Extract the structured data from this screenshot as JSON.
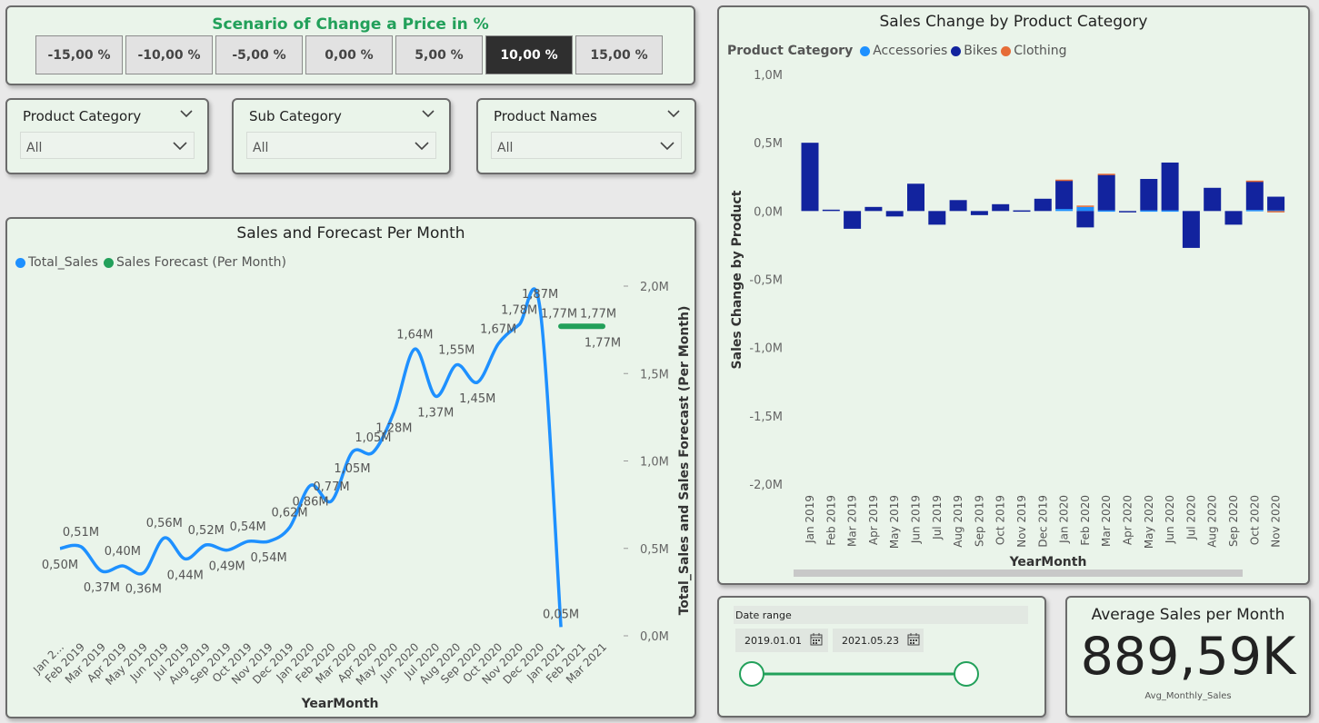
{
  "scenario": {
    "title": "Scenario of Change a Price in %",
    "options": [
      "-15,00 %",
      "-10,00 %",
      "-5,00 %",
      "0,00 %",
      "5,00 %",
      "10,00 %",
      "15,00 %"
    ],
    "selected": "10,00 %"
  },
  "slicers": [
    {
      "title": "Product Category",
      "value": "All"
    },
    {
      "title": "Sub Category",
      "value": "All"
    },
    {
      "title": "Product Names",
      "value": "All"
    }
  ],
  "line_chart": {
    "title": "Sales and Forecast Per Month",
    "legend": [
      {
        "name": "Total_Sales",
        "color": "#1e90ff"
      },
      {
        "name": "Sales Forecast (Per Month)",
        "color": "#22a05a"
      }
    ],
    "xlabel": "YearMonth",
    "ylabel": "Total_Sales and Sales Forecast (Per Month)"
  },
  "bar_chart": {
    "title": "Sales Change by Product Category",
    "legend_title": "Product Category",
    "legend": [
      {
        "name": "Accessories",
        "color": "#1e90ff"
      },
      {
        "name": "Bikes",
        "color": "#12239e"
      },
      {
        "name": "Clothing",
        "color": "#e66c37"
      }
    ],
    "xlabel": "YearMonth",
    "ylabel": "Sales Change by Product"
  },
  "date_range": {
    "title": "Date range",
    "start": "2019.01.01",
    "end": "2021.05.23",
    "start_icon": "calendar-icon",
    "end_icon": "calendar-icon",
    "slider_color": "#22a05a"
  },
  "kpi": {
    "title": "Average Sales per Month",
    "value": "889,59K",
    "label": "Avg_Monthly_Sales"
  },
  "chart_data": [
    {
      "type": "line",
      "title": "Sales and Forecast Per Month",
      "xlabel": "YearMonth",
      "ylabel": "Total_Sales and Sales Forecast (Per Month)",
      "x": [
        "Jan 2...",
        "Feb 2019",
        "Mar 2019",
        "Apr 2019",
        "May 2019",
        "Jun 2019",
        "Jul 2019",
        "Aug 2019",
        "Sep 2019",
        "Oct 2019",
        "Nov 2019",
        "Dec 2019",
        "Jan 2020",
        "Feb 2020",
        "Mar 2020",
        "Apr 2020",
        "May 2020",
        "Jun 2020",
        "Jul 2020",
        "Aug 2020",
        "Sep 2020",
        "Oct 2020",
        "Nov 2020",
        "Dec 2020",
        "Jan 2021",
        "Feb 2021",
        "Mar 2021"
      ],
      "y_ticks": [
        "0,0M",
        "0,5M",
        "1,0M",
        "1,5M",
        "2,0M"
      ],
      "ylim": [
        0,
        2.0
      ],
      "grid": false,
      "legend_position": "top-left",
      "series": [
        {
          "name": "Total_Sales",
          "color": "#1e90ff",
          "values": [
            0.5,
            0.51,
            0.37,
            0.4,
            0.36,
            0.56,
            0.44,
            0.52,
            0.49,
            0.54,
            0.54,
            0.62,
            0.86,
            0.77,
            1.05,
            1.05,
            1.28,
            1.64,
            1.37,
            1.55,
            1.45,
            1.67,
            1.78,
            1.87,
            0.05,
            null,
            null
          ],
          "labels": [
            "0,50M",
            "0,51M",
            "0,37M",
            "0,40M",
            "0,36M",
            "0,56M",
            "0,44M",
            "0,52M",
            "0,49M",
            "0,54M",
            "0,54M",
            "0,62M",
            "0,86M",
            "0,77M",
            "1,05M",
            "1,05M",
            "1,28M",
            "1,64M",
            "1,37M",
            "1,55M",
            "1,45M",
            "1,67M",
            "1,78M",
            "1,87M",
            "0,05M",
            "",
            ""
          ]
        },
        {
          "name": "Sales Forecast (Per Month)",
          "color": "#22a05a",
          "values": [
            null,
            null,
            null,
            null,
            null,
            null,
            null,
            null,
            null,
            null,
            null,
            null,
            null,
            null,
            null,
            null,
            null,
            null,
            null,
            null,
            null,
            null,
            null,
            null,
            1.77,
            1.77,
            1.77
          ],
          "labels": [
            "",
            "",
            "",
            "",
            "",
            "",
            "",
            "",
            "",
            "",
            "",
            "",
            "",
            "",
            "",
            "",
            "",
            "",
            "",
            "",
            "",
            "",
            "",
            "",
            "1,77M",
            "1,77M",
            "1,77M"
          ]
        }
      ]
    },
    {
      "type": "bar",
      "stacked": true,
      "title": "Sales Change by Product Category",
      "xlabel": "YearMonth",
      "ylabel": "Sales Change by Product",
      "categories": [
        "Jan 2019",
        "Feb 2019",
        "Mar 2019",
        "Apr 2019",
        "May 2019",
        "Jun 2019",
        "Jul 2019",
        "Aug 2019",
        "Sep 2019",
        "Oct 2019",
        "Nov 2019",
        "Dec 2019",
        "Jan 2020",
        "Feb 2020",
        "Mar 2020",
        "Apr 2020",
        "May 2020",
        "Jun 2020",
        "Jul 2020",
        "Aug 2020",
        "Sep 2020",
        "Oct 2020",
        "Nov 2020"
      ],
      "y_ticks": [
        "1,0M",
        "0,5M",
        "0,0M",
        "-0,5M",
        "-1,0M",
        "-1,5M",
        "-2,0M"
      ],
      "ylim": [
        -2.0,
        1.0
      ],
      "grid": false,
      "legend_position": "top-left",
      "series": [
        {
          "name": "Accessories",
          "color": "#1e90ff",
          "values": [
            0,
            0,
            0,
            0,
            0,
            0,
            0,
            0,
            0,
            0,
            0,
            0,
            0.015,
            0.03,
            0.005,
            0,
            0.005,
            0.005,
            0,
            0,
            0,
            0.008,
            0.005
          ]
        },
        {
          "name": "Bikes",
          "color": "#12239e",
          "values": [
            0.5,
            0.01,
            -0.13,
            0.03,
            -0.04,
            0.2,
            -0.1,
            0.08,
            -0.03,
            0.05,
            0.005,
            0.09,
            0.21,
            -0.12,
            0.26,
            -0.005,
            0.23,
            0.35,
            -0.27,
            0.17,
            -0.1,
            0.21,
            0.1
          ]
        },
        {
          "name": "Clothing",
          "color": "#e66c37",
          "values": [
            0,
            0,
            0,
            0,
            0,
            0,
            0,
            0,
            0,
            0,
            0,
            0,
            0.005,
            0.01,
            0.008,
            0,
            0,
            0,
            0,
            0,
            0,
            0.005,
            -0.005
          ]
        }
      ]
    }
  ]
}
